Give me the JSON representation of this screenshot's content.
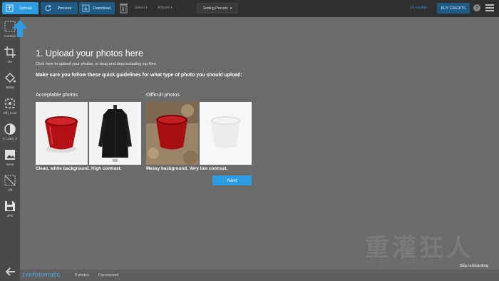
{
  "toolbar": {
    "upload_label": "Upload",
    "process_label": "Process",
    "download_label": "Download",
    "select_label": "Select ▾",
    "artwork_label": "Artwork ▾",
    "presets_label": "Setting Presets",
    "presets_caret": "▾",
    "credits_text": "10 credits",
    "buy_credits_label": "BUY CREDITS",
    "help_label": "?"
  },
  "sidebar": {
    "items": [
      {
        "label": "Autosize",
        "icon": "autosize-icon"
      },
      {
        "label": "On",
        "icon": "crop-icon"
      },
      {
        "label": "White",
        "icon": "fill-bucket-icon"
      },
      {
        "label": "Off | Auto",
        "icon": "shadow-icon"
      },
      {
        "label": "0 | 100 | 0",
        "icon": "contrast-icon"
      },
      {
        "label": "None",
        "icon": "image-icon"
      },
      {
        "label": "Off",
        "icon": "transparent-icon"
      },
      {
        "label": "JPG",
        "icon": "save-icon"
      }
    ]
  },
  "main": {
    "heading": "1. Upload your photos here",
    "subtext": "Click here to upload your photos, or drag and drop including zip files.",
    "guidelines": "Make sure you follow these quick guidelines for what type of photo you should upload:",
    "acceptable_title": "Acceptable photos",
    "difficult_title": "Difficult photos",
    "acceptable_caption": "Clean, white background. High contrast.",
    "difficult_caption": "Messy background. Very low contrast.",
    "next_label": "Next"
  },
  "footer": {
    "logo": "zenfotomatic",
    "photos_count": "0 photos",
    "processed_count": "0 processed",
    "skip_label": "Skip onboarding"
  },
  "watermark": {
    "glyphs": "重灌狂人",
    "url": "HTTP://BRIAN.C..."
  },
  "colors": {
    "accent": "#2e9ce0",
    "toolbar_bg": "#2f2f2f",
    "overlay_bg": "#6b6b6b"
  }
}
